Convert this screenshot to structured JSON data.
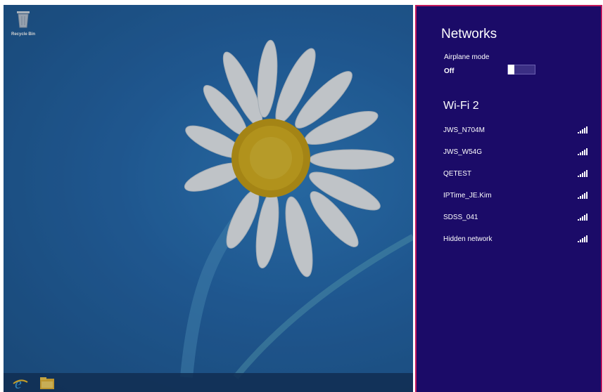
{
  "desktop": {
    "recycle_bin_label": "Recycle Bin",
    "taskbar": {
      "icons": [
        "internet-explorer-icon",
        "file-explorer-icon"
      ]
    }
  },
  "networks_pane": {
    "title": "Networks",
    "airplane_mode": {
      "label": "Airplane mode",
      "state": "Off",
      "on": false
    },
    "section_title": "Wi-Fi 2",
    "networks": [
      {
        "name": "JWS_N704M"
      },
      {
        "name": "JWS_W54G"
      },
      {
        "name": "QETEST"
      },
      {
        "name": "IPTime_JE.Kim"
      },
      {
        "name": "SDSS_041"
      },
      {
        "name": "Hidden network"
      }
    ]
  },
  "colors": {
    "pane_background": "#1b0b68",
    "pane_border": "#c2185b",
    "desktop_background": "#2669ad"
  }
}
